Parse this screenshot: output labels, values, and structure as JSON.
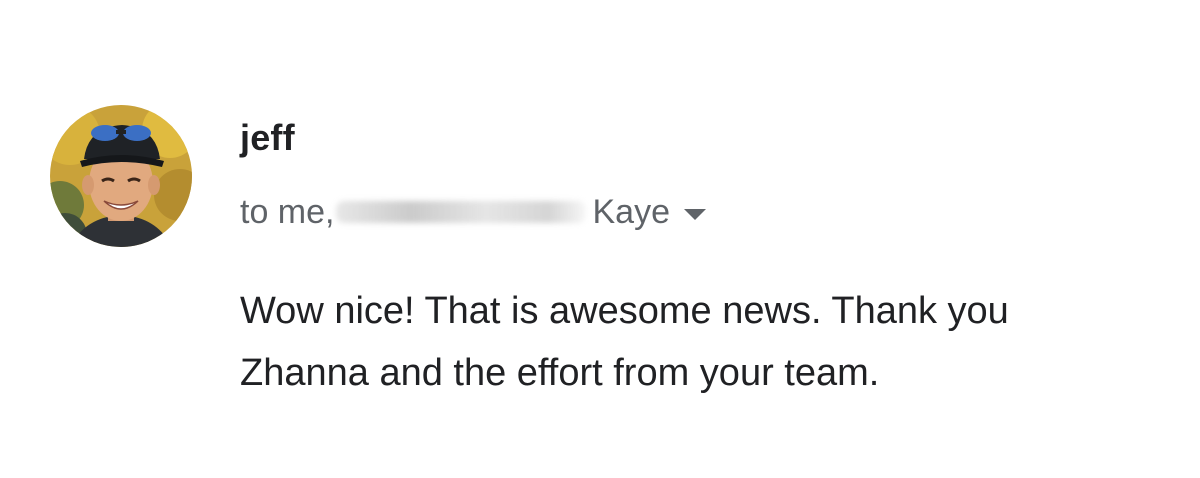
{
  "email": {
    "sender": {
      "name": "jeff",
      "avatar": "profile-photo"
    },
    "recipients": {
      "prefix": "to me,",
      "visible_name": "Kaye",
      "details_icon": "caret-down-icon"
    },
    "body": {
      "line1": "Wow nice! That is awesome news. Thank you",
      "line2": "Zhanna and the effort from your team."
    }
  }
}
